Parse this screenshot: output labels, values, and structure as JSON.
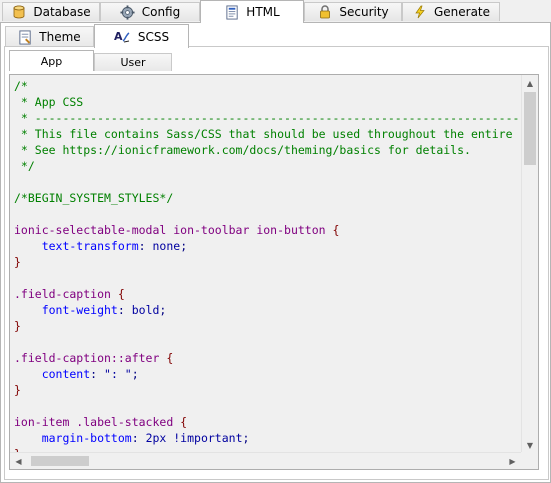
{
  "top_tabs": [
    {
      "label": "Database",
      "icon": "database-icon"
    },
    {
      "label": "Config",
      "icon": "config-gear-icon"
    },
    {
      "label": "HTML",
      "icon": "html-document-icon"
    },
    {
      "label": "Security",
      "icon": "lock-icon"
    },
    {
      "label": "Generate",
      "icon": "lightning-icon"
    }
  ],
  "active_top_tab": "HTML",
  "sub_tabs": [
    {
      "label": "Theme",
      "icon": "theme-document-icon"
    },
    {
      "label": "SCSS",
      "icon": "scss-icon"
    }
  ],
  "active_sub_tab": "SCSS",
  "scss_tabs": [
    {
      "label": "App"
    },
    {
      "label": "User"
    }
  ],
  "active_scss_tab": "App",
  "code_lines": [
    "/*",
    " * App CSS",
    " * -----------------------------------------------------------------------",
    " * This file contains Sass/CSS that should be used throughout the entire app.",
    " * See https://ionicframework.com/docs/theming/basics for details.",
    " */",
    "",
    "/*BEGIN_SYSTEM_STYLES*/",
    "",
    "ionic-selectable-modal ion-toolbar ion-button {",
    "    text-transform: none;",
    "}",
    "",
    ".field-caption {",
    "    font-weight: bold;",
    "}",
    "",
    ".field-caption::after {",
    "    content: \": \";",
    "}",
    "",
    "ion-item .label-stacked {",
    "    margin-bottom: 2px !important;",
    "}",
    ""
  ],
  "colors": {
    "comment": "#008000",
    "selector": "#800080",
    "brace": "#800000",
    "property": "#0000ff",
    "value": "#0000a0"
  }
}
